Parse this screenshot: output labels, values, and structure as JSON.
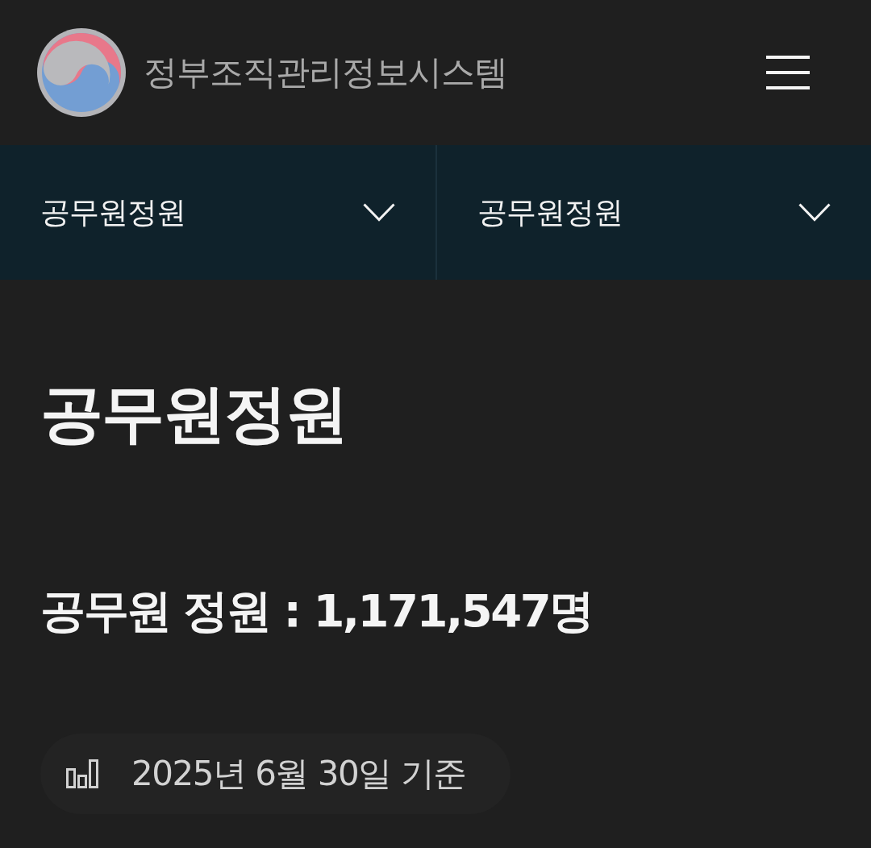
{
  "header": {
    "title": "정부조직관리정보시스템"
  },
  "nav": {
    "dropdowns": [
      {
        "label": "공무원정원"
      },
      {
        "label": "공무원정원"
      }
    ]
  },
  "page": {
    "heading": "공무원정원",
    "summary": "공무원 정원 : 1,171,547명",
    "as_of": "2025년 6월 30일 기준"
  }
}
